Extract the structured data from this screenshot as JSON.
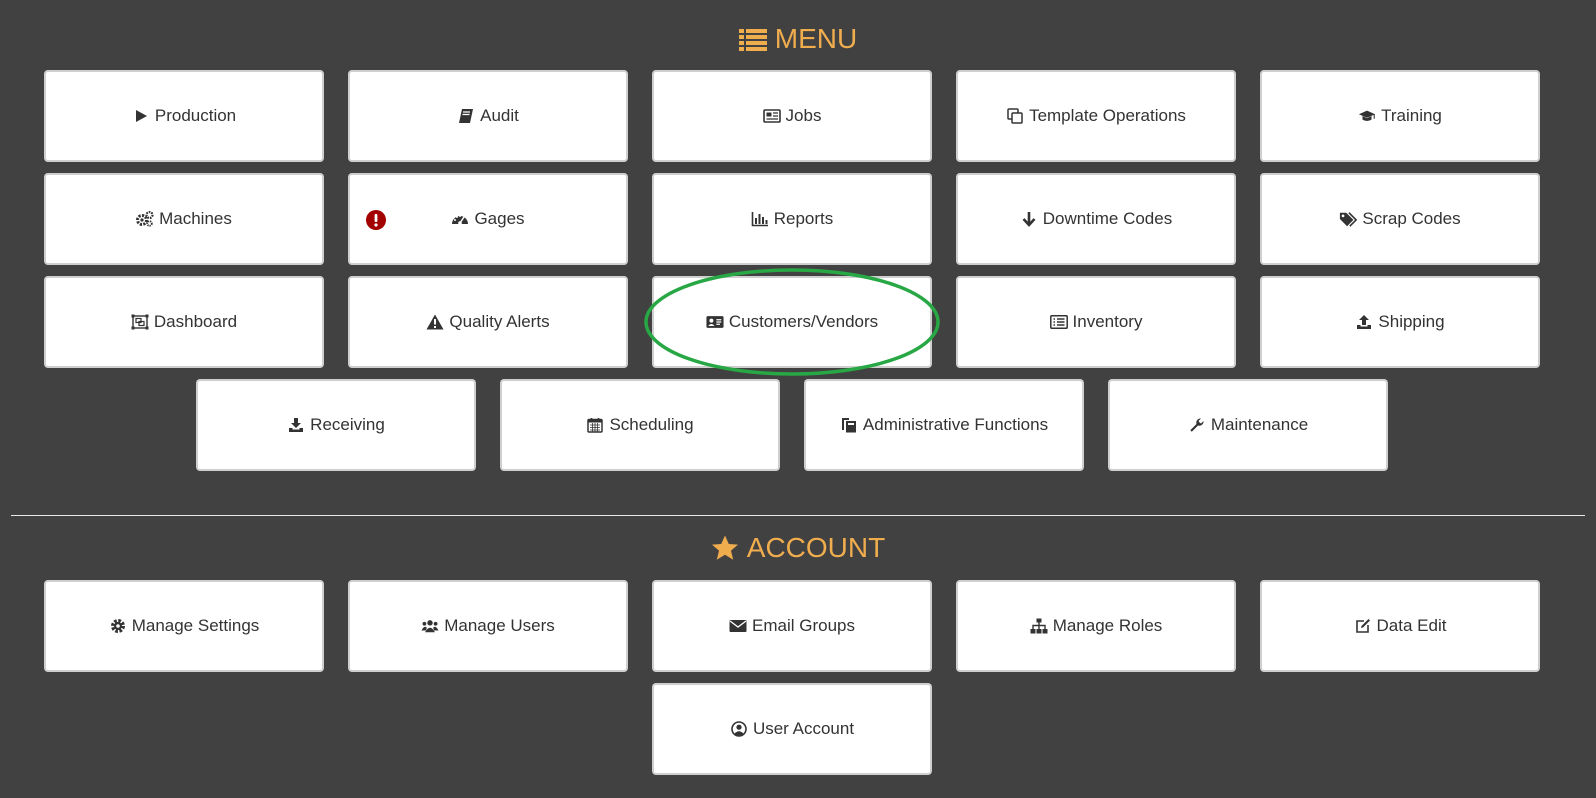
{
  "menu": {
    "title": "MENU",
    "title_icon": "list-icon",
    "items": [
      {
        "label": "Production",
        "icon": "play-icon"
      },
      {
        "label": "Audit",
        "icon": "book-icon"
      },
      {
        "label": "Jobs",
        "icon": "newspaper-icon"
      },
      {
        "label": "Template Operations",
        "icon": "copy-icon"
      },
      {
        "label": "Training",
        "icon": "graduation-cap-icon"
      },
      {
        "label": "Machines",
        "icon": "gears-icon"
      },
      {
        "label": "Gages",
        "icon": "gauge-icon",
        "badge": "exclamation-circle-icon"
      },
      {
        "label": "Reports",
        "icon": "bar-chart-icon"
      },
      {
        "label": "Downtime Codes",
        "icon": "arrow-down-icon"
      },
      {
        "label": "Scrap Codes",
        "icon": "tags-icon"
      },
      {
        "label": "Dashboard",
        "icon": "object-group-icon"
      },
      {
        "label": "Quality Alerts",
        "icon": "warning-icon"
      },
      {
        "label": "Customers/Vendors",
        "icon": "id-card-icon"
      },
      {
        "label": "Inventory",
        "icon": "list-alt-icon"
      },
      {
        "label": "Shipping",
        "icon": "upload-icon"
      },
      {
        "label": "Receiving",
        "icon": "download-icon"
      },
      {
        "label": "Scheduling",
        "icon": "calendar-icon"
      },
      {
        "label": "Administrative Functions",
        "icon": "clipboard-icon"
      },
      {
        "label": "Maintenance",
        "icon": "wrench-icon"
      }
    ]
  },
  "account": {
    "title": "ACCOUNT",
    "title_icon": "star-icon",
    "items": [
      {
        "label": "Manage Settings",
        "icon": "cog-icon"
      },
      {
        "label": "Manage Users",
        "icon": "users-icon"
      },
      {
        "label": "Email Groups",
        "icon": "envelope-icon"
      },
      {
        "label": "Manage Roles",
        "icon": "sitemap-icon"
      },
      {
        "label": "Data Edit",
        "icon": "edit-icon"
      },
      {
        "label": "User Account",
        "icon": "user-circle-icon"
      }
    ]
  },
  "colors": {
    "background": "#414141",
    "accent": "#f0ad4e",
    "tile": "#ffffff",
    "badge": "#a30000",
    "highlight": "#28a745"
  }
}
